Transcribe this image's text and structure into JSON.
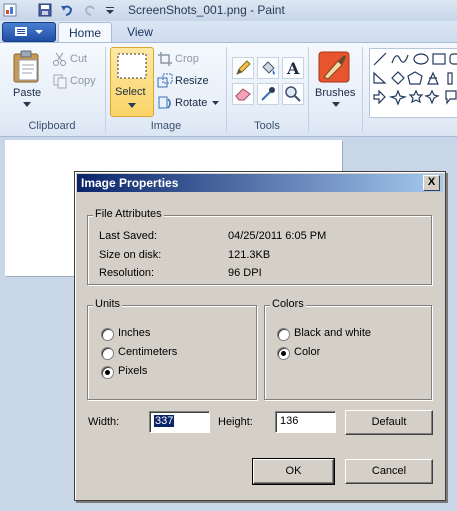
{
  "window": {
    "title": "ScreenShots_001.png - Paint"
  },
  "tabs": [
    {
      "label": "Home"
    },
    {
      "label": "View"
    }
  ],
  "ribbon": {
    "clipboard": {
      "label": "Clipboard",
      "paste": "Paste",
      "cut": "Cut",
      "copy": "Copy"
    },
    "image": {
      "label": "Image",
      "select": "Select",
      "crop": "Crop",
      "resize": "Resize",
      "rotate": "Rotate"
    },
    "tools": {
      "label": "Tools"
    },
    "brushes": {
      "label": "Brushes"
    }
  },
  "dialog": {
    "title": "Image Properties",
    "close": "X",
    "file_attributes": {
      "title": "File Attributes",
      "rows": [
        {
          "label": "Last Saved:",
          "value": "04/25/2011 6:05 PM"
        },
        {
          "label": "Size on disk:",
          "value": "121.3KB"
        },
        {
          "label": "Resolution:",
          "value": "96 DPI"
        }
      ]
    },
    "units": {
      "title": "Units",
      "options": [
        {
          "label": "Inches",
          "selected": false
        },
        {
          "label": "Centimeters",
          "selected": false
        },
        {
          "label": "Pixels",
          "selected": true
        }
      ]
    },
    "colors": {
      "title": "Colors",
      "options": [
        {
          "label": "Black and white",
          "selected": false
        },
        {
          "label": "Color",
          "selected": true
        }
      ]
    },
    "width": {
      "label": "Width:",
      "value": "337"
    },
    "height": {
      "label": "Height:",
      "value": "136"
    },
    "buttons": {
      "default": "Default",
      "ok": "OK",
      "cancel": "Cancel"
    }
  },
  "colors": {
    "accent": "#0a246a",
    "dialog_bg": "#d4d0c8",
    "ribbon_bg": "#dce6f3",
    "select_highlight": "#fbd468"
  }
}
